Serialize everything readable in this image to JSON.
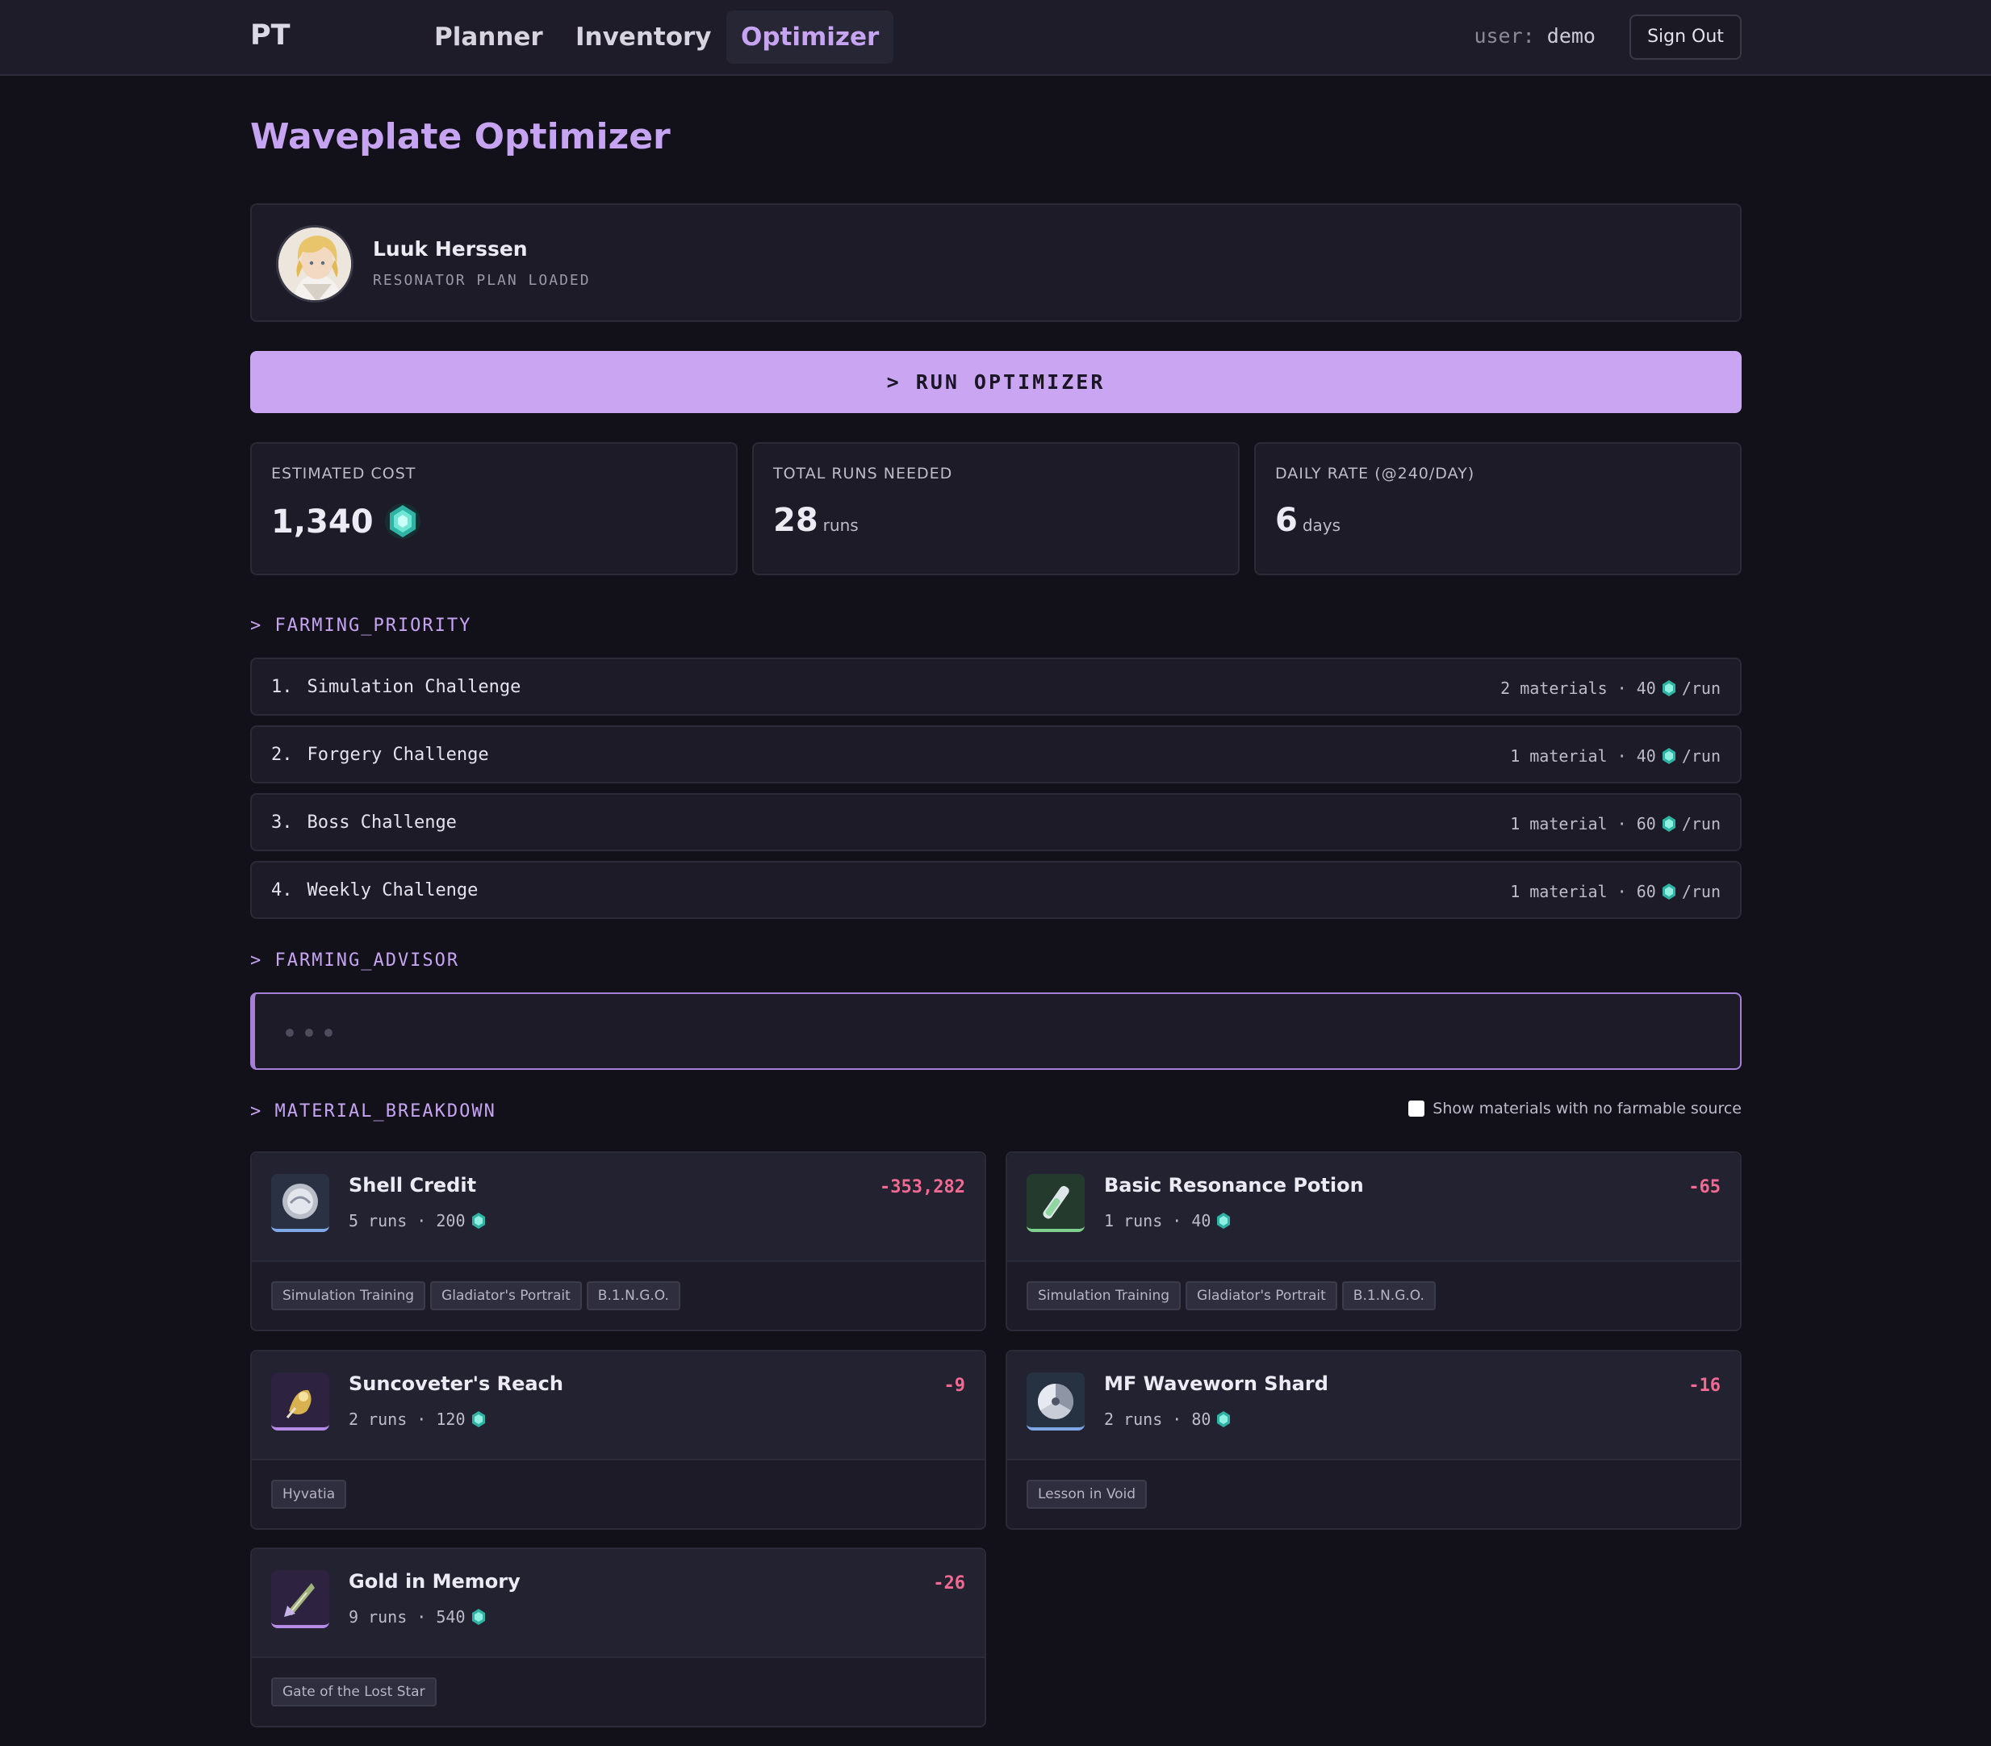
{
  "nav": {
    "logo": "PT",
    "links": [
      "Planner",
      "Inventory",
      "Optimizer"
    ],
    "active": "Optimizer",
    "user_label": "user:",
    "user_name": "demo",
    "signout_label": "Sign Out"
  },
  "page": {
    "title": "Waveplate Optimizer"
  },
  "profile": {
    "name": "Luuk Herssen",
    "status": "RESONATOR PLAN LOADED"
  },
  "run_button": "> RUN OPTIMIZER",
  "stats": [
    {
      "label": "ESTIMATED COST",
      "value": "1,340",
      "unit": ""
    },
    {
      "label": "TOTAL RUNS NEEDED",
      "value": "28",
      "unit": "runs"
    },
    {
      "label": "DAILY RATE (@240/DAY)",
      "value": "6",
      "unit": "days"
    }
  ],
  "farming_priority": {
    "heading": "> FARMING_PRIORITY",
    "items": [
      {
        "num": "1.",
        "name": "Simulation Challenge",
        "materials": "2 materials",
        "cost": "40",
        "per": "/run"
      },
      {
        "num": "2.",
        "name": "Forgery Challenge",
        "materials": "1 material",
        "cost": "40",
        "per": "/run"
      },
      {
        "num": "3.",
        "name": "Boss Challenge",
        "materials": "1 material",
        "cost": "60",
        "per": "/run"
      },
      {
        "num": "4.",
        "name": "Weekly Challenge",
        "materials": "1 material",
        "cost": "60",
        "per": "/run"
      }
    ]
  },
  "farming_advisor": {
    "heading": "> FARMING_ADVISOR"
  },
  "material_breakdown": {
    "heading": "> MATERIAL_BREAKDOWN",
    "checkbox_label": "Show materials with no farmable source",
    "items": [
      {
        "name": "Shell Credit",
        "runs": "5 runs",
        "cost": "200",
        "delta": "-353,282",
        "tags": [
          "Simulation Training",
          "Gladiator's Portrait",
          "B.1.N.G.O."
        ]
      },
      {
        "name": "Basic Resonance Potion",
        "runs": "1 runs",
        "cost": "40",
        "delta": "-65",
        "tags": [
          "Simulation Training",
          "Gladiator's Portrait",
          "B.1.N.G.O."
        ]
      },
      {
        "name": "Suncoveter's Reach",
        "runs": "2 runs",
        "cost": "120",
        "delta": "-9",
        "tags": [
          "Hyvatia"
        ]
      },
      {
        "name": "MF Waveworn Shard",
        "runs": "2 runs",
        "cost": "80",
        "delta": "-16",
        "tags": [
          "Lesson in Void"
        ]
      },
      {
        "name": "Gold in Memory",
        "runs": "9 runs",
        "cost": "540",
        "delta": "-26",
        "tags": [
          "Gate of the Lost Star"
        ]
      }
    ]
  },
  "colors": {
    "accent": "#c7a4f2",
    "negative": "#f06a92",
    "gem": "#4fd6c3"
  }
}
